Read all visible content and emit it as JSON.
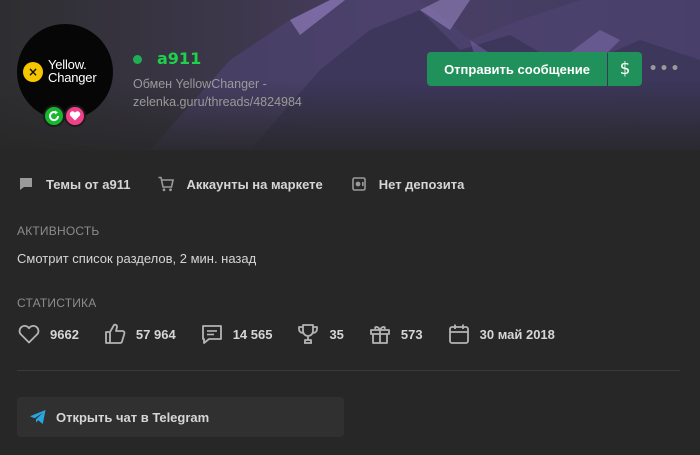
{
  "profile": {
    "username": "a911",
    "username_color": "#1ed14b",
    "online": true,
    "subtitle_line1": "Обмен YellowChanger -",
    "subtitle_line2": "zelenka.guru/threads/4824984",
    "avatar": {
      "logo_line1": "Yellow.",
      "logo_line2": "Changer",
      "logo_mark": "×"
    },
    "badges": [
      "refresh-icon",
      "heart-icon"
    ]
  },
  "actions": {
    "send_message": "Отправить сообщение",
    "money": "$",
    "more": "•••"
  },
  "links": [
    {
      "icon": "comment-icon",
      "label": "Темы от a911"
    },
    {
      "icon": "cart-icon",
      "label": "Аккаунты на маркете"
    },
    {
      "icon": "deposit-icon",
      "label": "Нет депозита"
    }
  ],
  "activity": {
    "heading": "АКТИВНОСТЬ",
    "text": "Смотрит список разделов, 2 мин. назад"
  },
  "stats": {
    "heading": "СТАТИСТИКА",
    "items": [
      {
        "icon": "heart-icon",
        "value": "9662"
      },
      {
        "icon": "thumbs-up-icon",
        "value": "57 964"
      },
      {
        "icon": "message-icon",
        "value": "14 565"
      },
      {
        "icon": "trophy-icon",
        "value": "35"
      },
      {
        "icon": "gift-icon",
        "value": "573"
      },
      {
        "icon": "calendar-icon",
        "value": "30 май 2018"
      }
    ]
  },
  "telegram": {
    "label": "Открыть чат в Telegram",
    "icon": "telegram-icon"
  },
  "colors": {
    "accent_button": "#20915a",
    "page_bg": "#272727",
    "online_dot": "#1fae54",
    "telegram_blue": "#2aa5e0"
  }
}
